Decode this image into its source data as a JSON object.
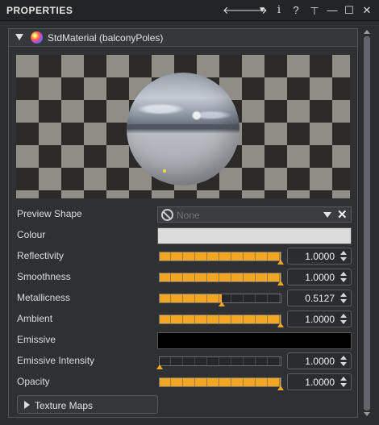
{
  "window": {
    "title": "PROPERTIES",
    "buttons": {
      "back": "🡐",
      "forward": "🡒",
      "menu": "▼",
      "info": "i",
      "help": "?",
      "pin": "⊥",
      "minimize": "—",
      "maximize": "☐",
      "close": "✕"
    }
  },
  "material": {
    "title": "StdMaterial (balconyPoles)",
    "icon": "material-sphere-icon"
  },
  "properties": {
    "preview_shape": {
      "label": "Preview Shape",
      "value": "None",
      "placeholder_icon": "no-entry-icon",
      "clear": "✕"
    },
    "colour": {
      "label": "Colour",
      "color": "#dcdcdc"
    },
    "reflectivity": {
      "label": "Reflectivity",
      "value": "1.0000",
      "fraction": 1.0
    },
    "smoothness": {
      "label": "Smoothness",
      "value": "1.0000",
      "fraction": 1.0
    },
    "metallicness": {
      "label": "Metallicness",
      "value": "0.5127",
      "fraction": 0.5127
    },
    "ambient": {
      "label": "Ambient",
      "value": "1.0000",
      "fraction": 1.0
    },
    "emissive": {
      "label": "Emissive",
      "color": "#000000"
    },
    "emissive_intensity": {
      "label": "Emissive Intensity",
      "value": "1.0000",
      "fraction": 0.0
    },
    "opacity": {
      "label": "Opacity",
      "value": "1.0000",
      "fraction": 1.0
    }
  },
  "texture_maps": {
    "label": "Texture Maps"
  },
  "colors": {
    "accent": "#f5a623",
    "background": "#2b2d2f",
    "panel": "#2e3032"
  }
}
